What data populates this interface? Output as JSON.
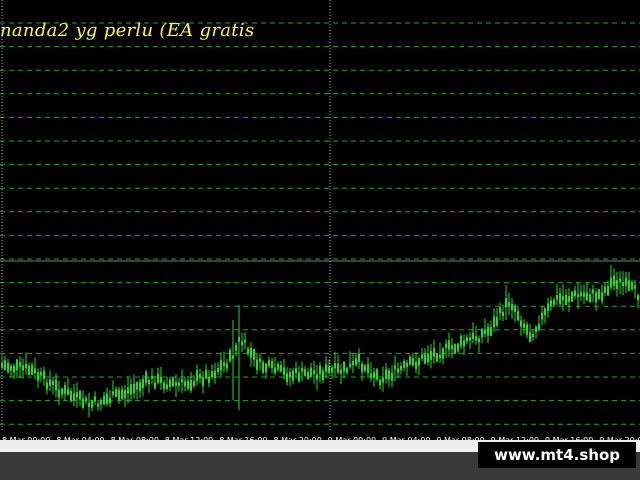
{
  "overlay_text": "nanda2 yg perlu (EA gratis",
  "watermark": "www.mt4.shop",
  "colors": {
    "background": "#000000",
    "candle": "#22dd22",
    "grid": "#1fa51f",
    "separator": "#777777",
    "text": "#ffff33"
  },
  "chart_data": {
    "type": "candlestick",
    "x_tick_labels": [
      "8 Mar 00:00",
      "8 Mar 04:00",
      "8 Mar 08:00",
      "8 Mar 12:00",
      "8 Mar 16:00",
      "8 Mar 20:00",
      "9 Mar 00:00",
      "9 Mar 04:00",
      "9 Mar 08:00",
      "9 Mar 12:00",
      "9 Mar 16:00",
      "9 Mar 20:00"
    ],
    "grid": true
  }
}
